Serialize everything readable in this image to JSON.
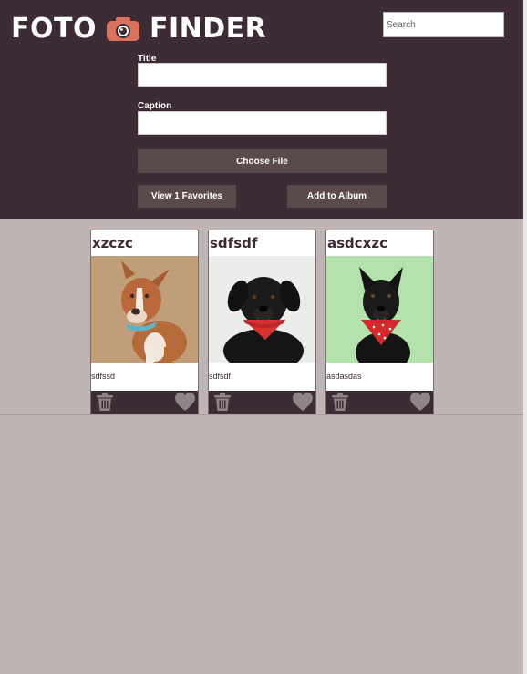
{
  "app": {
    "logo_left": "FOTO",
    "logo_right": "FINDER"
  },
  "search": {
    "placeholder": "Search"
  },
  "form": {
    "title_label": "Title",
    "caption_label": "Caption",
    "choose_file_label": "Choose File",
    "view_favorites_label": "View 1 Favorites",
    "add_to_album_label": "Add to Album"
  },
  "cards": [
    {
      "title": "xzczc",
      "caption": "sdfssd",
      "photo": "tan-white-dog-blue-collar"
    },
    {
      "title": "sdfsdf",
      "caption": "sdfsdf",
      "photo": "black-dog-red-bandana"
    },
    {
      "title": "asdcxzc",
      "caption": "asdasdas",
      "photo": "black-dog-red-bandana-green-background"
    }
  ],
  "icons": {
    "delete": "trash-icon",
    "favorite": "heart-icon"
  },
  "colors": {
    "header_bg": "#3d2c36",
    "button_bg": "#5b4a4c",
    "page_bg": "#bfb4b4",
    "accent_camera": "#d9735c",
    "icon_color": "#8f8486"
  }
}
